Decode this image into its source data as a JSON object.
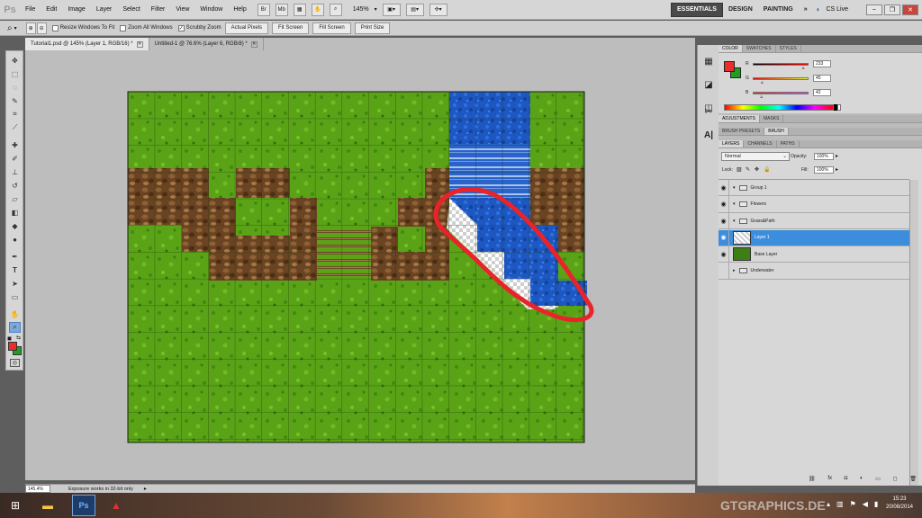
{
  "app": {
    "logo": "Ps"
  },
  "menu": [
    "File",
    "Edit",
    "Image",
    "Layer",
    "Select",
    "Filter",
    "View",
    "Window",
    "Help"
  ],
  "menubar_controls": {
    "br_label": "Br",
    "mb_label": "Mb",
    "zoom": "145%"
  },
  "workspaces": [
    "ESSENTIALS",
    "DESIGN",
    "PAINTING"
  ],
  "workspaces_more": "»",
  "cs_live": "CS Live",
  "window_controls": {
    "minimize": "–",
    "restore": "❐",
    "close": "✕"
  },
  "options": {
    "resize_windows": "Resize Windows To Fit",
    "zoom_all": "Zoom All Windows",
    "scrubby_zoom": "Scrubby Zoom",
    "scrubby_checked": "✓",
    "actual_pixels": "Actual Pixels",
    "fit_screen": "Fit Screen",
    "fill_screen": "Fill Screen",
    "print_size": "Print Size"
  },
  "doc_tabs": [
    {
      "label": "Tutorial1.psd @ 145% (Layer 1, RGB/16) *",
      "close": "✕"
    },
    {
      "label": "Untitled-1 @ 76.6% (Layer 6, RGB/8) *",
      "close": "✕"
    }
  ],
  "status": {
    "zoom": "145.4%",
    "message": "Exposure works in 32-bit only"
  },
  "color_panel": {
    "tabs": [
      "COLOR",
      "SWATCHES",
      "STYLES"
    ],
    "r_label": "R",
    "g_label": "G",
    "b_label": "B",
    "r": "233",
    "g": "45",
    "b": "42",
    "r_level": 0.914,
    "g_level": 0.176,
    "b_level": 0.165,
    "fg_color": "#e92d2a",
    "bg_color": "#1ea01e"
  },
  "adjust_tabs": [
    "ADJUSTMENTS",
    "MASKS"
  ],
  "brush_tabs": [
    "BRUSH PRESETS",
    "BRUSH"
  ],
  "layers_panel": {
    "tabs": [
      "LAYERS",
      "CHANNELS",
      "PATHS"
    ],
    "blend_mode": "Normal",
    "opacity_label": "Opacity:",
    "opacity": "100%",
    "lock_label": "Lock:",
    "fill_label": "Fill:",
    "fill": "100%",
    "layers": [
      {
        "name": "Group 1",
        "type": "group",
        "visible": true,
        "selected": false
      },
      {
        "name": "Flowers",
        "type": "group",
        "visible": true,
        "selected": false
      },
      {
        "name": "Grass&Path",
        "type": "group",
        "visible": true,
        "selected": false
      },
      {
        "name": "Layer 1",
        "type": "layer",
        "visible": true,
        "selected": true
      },
      {
        "name": "Base Layer",
        "type": "layer",
        "visible": true,
        "selected": false
      },
      {
        "name": "Underwater",
        "type": "group",
        "visible": false,
        "selected": false
      }
    ],
    "bottom_icons": [
      "link-icon",
      "fx-icon",
      "mask-icon",
      "adjustment-icon",
      "folder-icon",
      "new-layer-icon",
      "trash-icon"
    ]
  },
  "tools": [
    "move",
    "marquee",
    "lasso",
    "quick-select",
    "crop",
    "eyedropper",
    "healing",
    "brush",
    "clone",
    "history-brush",
    "eraser",
    "gradient",
    "blur",
    "dodge",
    "pen",
    "type",
    "path-select",
    "shape",
    "hand",
    "zoom"
  ],
  "taskbar": {
    "time": "15:23",
    "date": "20/08/2014",
    "watermark": "GTGRAPHICS.DE",
    "ps_label": "Ps"
  },
  "colors": {
    "accent": "#3d8ddd",
    "annotation": "#e8242a"
  }
}
